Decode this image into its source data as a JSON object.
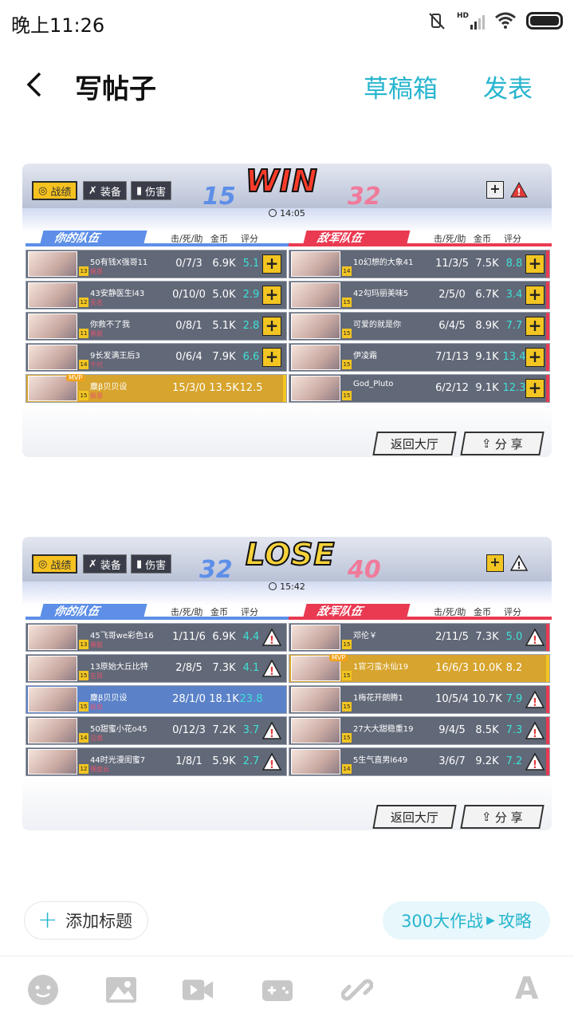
{
  "status_bar": {
    "time": "晚上11:26",
    "network": "HD"
  },
  "header": {
    "title": "写帖子",
    "draft": "草稿箱",
    "publish": "发表"
  },
  "common": {
    "tab_stats": "战绩",
    "tab_equip": "装备",
    "tab_damage": "伤害",
    "col_kda": "击/死/助",
    "col_gold": "金币",
    "col_score": "评分",
    "my_team": "你的队伍",
    "enemy_team": "敌军队伍",
    "btn_lobby": "返回大厅",
    "btn_share": "分 享"
  },
  "match1": {
    "result": "WIN",
    "left_score": "15",
    "right_score": "32",
    "time": "14:05",
    "my": [
      {
        "name": "50有钱X强哥11",
        "sub": "佩恩",
        "lv": "13",
        "kda": "0/7/3",
        "gold": "6.9K",
        "score": "5.1"
      },
      {
        "name": "43安静医生l43",
        "sub": "无名",
        "lv": "12",
        "kda": "0/10/0",
        "gold": "5.0K",
        "score": "2.9"
      },
      {
        "name": "你救不了我",
        "sub": "黑姬",
        "lv": "11",
        "kda": "0/8/1",
        "gold": "5.1K",
        "score": "2.8"
      },
      {
        "name": "9长发满王后3",
        "sub": "千代",
        "lv": "14",
        "kda": "0/6/4",
        "gold": "7.9K",
        "score": "6.6"
      },
      {
        "name": "麋β贝贝设",
        "sub": "佩恩",
        "lv": "15",
        "kda": "15/3/0",
        "gold": "13.5K",
        "score": "12.5",
        "mvp": "MVP"
      }
    ],
    "enemy": [
      {
        "name": "10幻想的大象41",
        "sub": "",
        "lv": "14",
        "kda": "11/3/5",
        "gold": "7.5K",
        "score": "8.8"
      },
      {
        "name": "42勾玛丽美味5",
        "sub": "",
        "lv": "15",
        "kda": "2/5/0",
        "gold": "6.7K",
        "score": "3.4"
      },
      {
        "name": "可爱的就是你",
        "sub": "",
        "lv": "15",
        "kda": "6/4/5",
        "gold": "8.9K",
        "score": "7.7"
      },
      {
        "name": "伊凌霜",
        "sub": "",
        "lv": "15",
        "kda": "7/1/13",
        "gold": "9.1K",
        "score": "13.4"
      },
      {
        "name": "God_Pluto",
        "sub": "",
        "lv": "15",
        "kda": "6/2/12",
        "gold": "9.1K",
        "score": "12.3"
      }
    ]
  },
  "match2": {
    "result": "LOSE",
    "left_score": "32",
    "right_score": "40",
    "time": "15:42",
    "my": [
      {
        "name": "45飞哥we彩色16",
        "sub": "黑姬",
        "lv": "13",
        "kda": "1/11/6",
        "gold": "6.9K",
        "score": "4.4"
      },
      {
        "name": "13原始大丘比特",
        "sub": "左目",
        "lv": "15",
        "kda": "2/8/5",
        "gold": "7.3K",
        "score": "4.1"
      },
      {
        "name": "麋β贝贝设",
        "sub": "佩恩",
        "lv": "15",
        "kda": "28/1/0",
        "gold": "18.1K",
        "score": "23.8"
      },
      {
        "name": "50甜蜜小花o45",
        "sub": "泣南",
        "lv": "14",
        "kda": "0/12/3",
        "gold": "7.2K",
        "score": "3.7"
      },
      {
        "name": "44时光漫闺蜜7",
        "sub": "惺庭云",
        "lv": "12",
        "kda": "1/8/1",
        "gold": "5.9K",
        "score": "2.7"
      }
    ],
    "enemy": [
      {
        "name": "邓伦￥",
        "sub": "",
        "lv": "15",
        "kda": "2/11/5",
        "gold": "7.3K",
        "score": "5.0"
      },
      {
        "name": "1官刁蛮水仙19",
        "sub": "",
        "lv": "15",
        "kda": "16/6/3",
        "gold": "10.0K",
        "score": "8.2",
        "mvp": "MVP"
      },
      {
        "name": "1梅花开朗腾1",
        "sub": "",
        "lv": "15",
        "kda": "10/5/4",
        "gold": "10.7K",
        "score": "7.9"
      },
      {
        "name": "27大大甜稳重19",
        "sub": "",
        "lv": "15",
        "kda": "9/4/5",
        "gold": "8.5K",
        "score": "7.3"
      },
      {
        "name": "5生气直男l649",
        "sub": "",
        "lv": "14",
        "kda": "3/6/7",
        "gold": "9.2K",
        "score": "7.2"
      }
    ]
  },
  "footer": {
    "add_title": "添加标题",
    "tag": "300大作战",
    "tag2": "攻略",
    "font_icon": "A"
  }
}
